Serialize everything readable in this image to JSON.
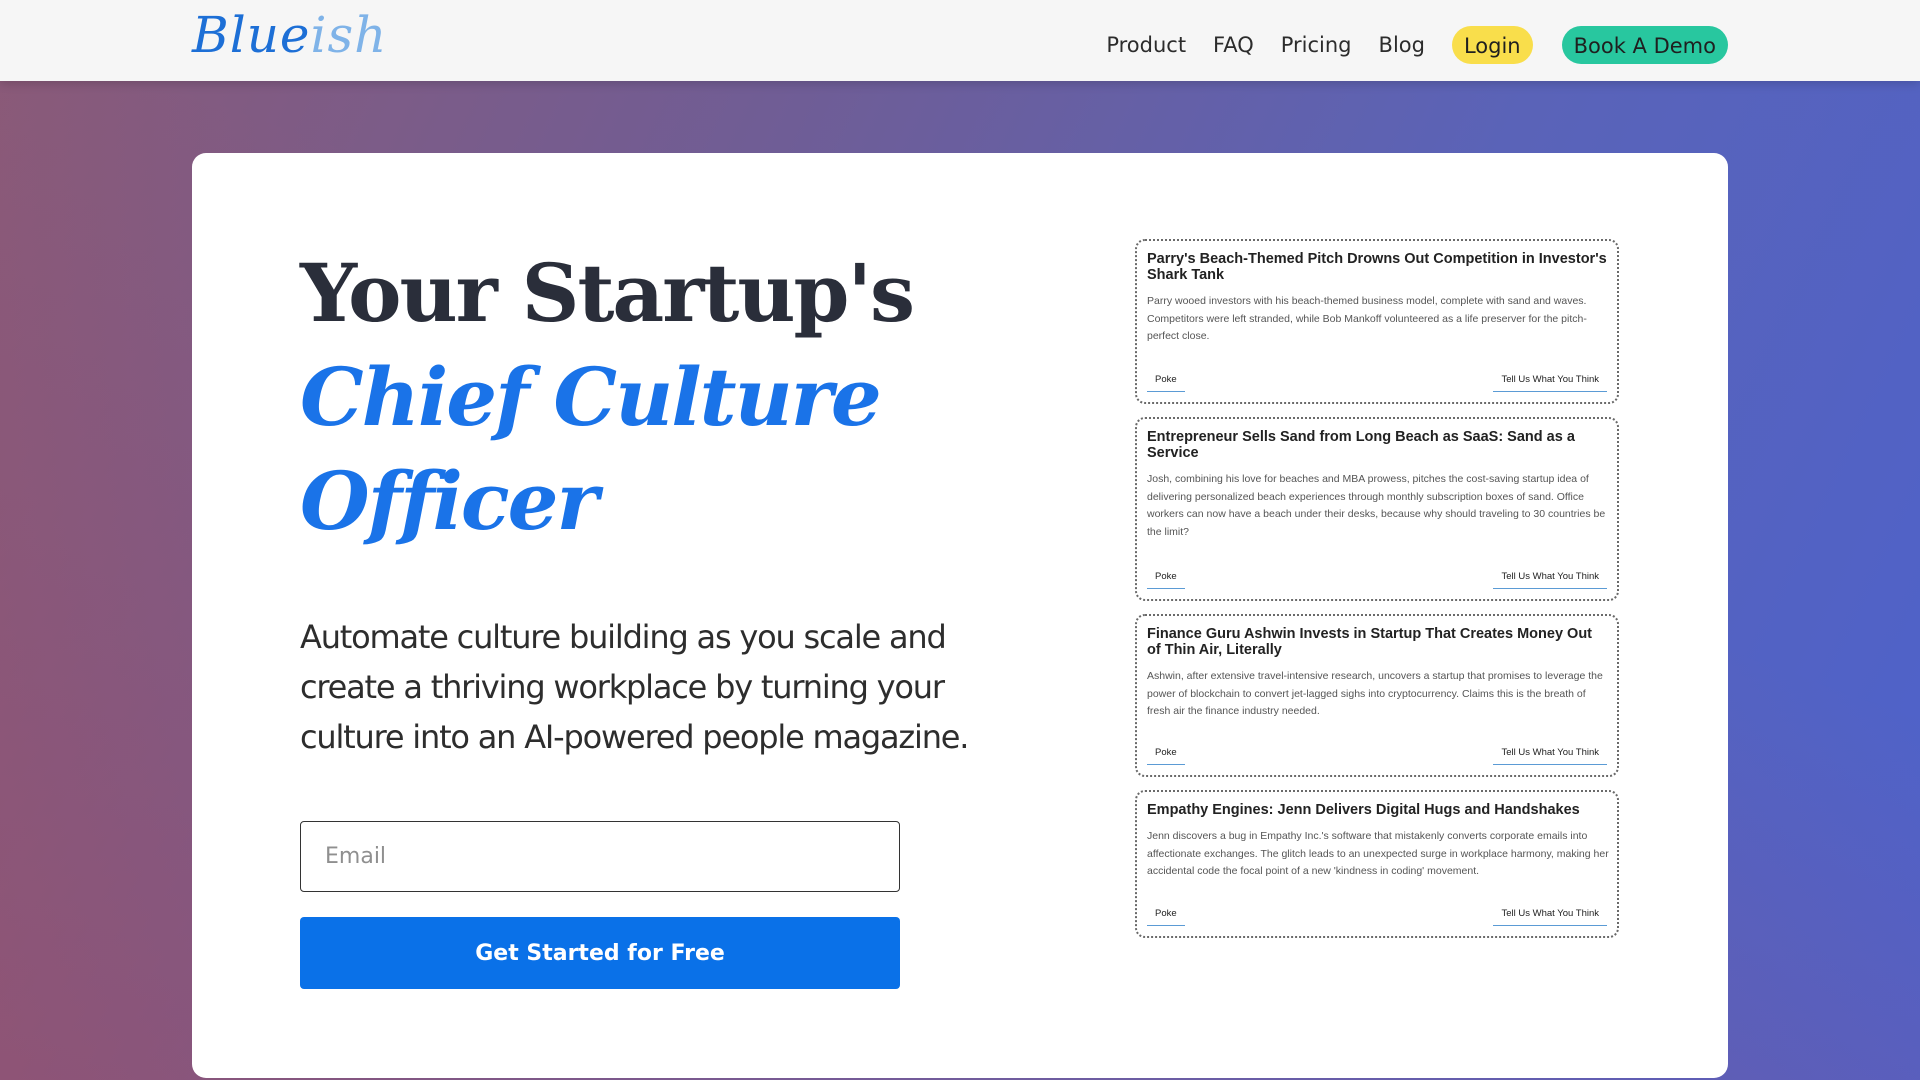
{
  "header": {
    "logo_main": "Blue",
    "logo_tail": "ish",
    "nav": {
      "product": "Product",
      "faq": "FAQ",
      "pricing": "Pricing",
      "blog": "Blog"
    },
    "login_label": "Login",
    "demo_label": "Book A Demo",
    "colors": {
      "login_bg": "#f9de4b",
      "demo_bg": "#28c79f",
      "logo": "#1d6fd6"
    }
  },
  "hero": {
    "headline_line1": "Your Startup's",
    "headline_line2": "Chief Culture",
    "headline_line3": "Officer",
    "subtext": "Automate culture building as you scale and create a thriving workplace by turning your culture into an AI-powered people magazine.",
    "email_placeholder": "Email",
    "email_value": "",
    "cta_label": "Get Started for Free",
    "accent_color": "#1a73e8",
    "cta_color": "#0a71e8"
  },
  "articles": [
    {
      "title": "Parry's Beach-Themed Pitch Drowns Out Competition in Investor's Shark Tank",
      "body": "Parry wooed investors with his beach-themed business model, complete with sand and waves. Competitors were left stranded, while Bob Mankoff volunteered as a life preserver for the pitch-perfect close.",
      "poke_label": "Poke",
      "feedback_label": "Tell Us What You Think"
    },
    {
      "title": "Entrepreneur Sells Sand from Long Beach as SaaS: Sand as a Service",
      "body": "Josh, combining his love for beaches and MBA prowess, pitches the cost-saving startup idea of delivering personalized beach experiences through monthly subscription boxes of sand. Office workers can now have a beach under their desks, because why should traveling to 30 countries be the limit?",
      "poke_label": "Poke",
      "feedback_label": "Tell Us What You Think"
    },
    {
      "title": "Finance Guru Ashwin Invests in Startup That Creates Money Out of Thin Air, Literally",
      "body": "Ashwin, after extensive travel-intensive research, uncovers a startup that promises to leverage the power of blockchain to convert jet-lagged sighs into cryptocurrency. Claims this is the breath of fresh air the finance industry needed.",
      "poke_label": "Poke",
      "feedback_label": "Tell Us What You Think"
    },
    {
      "title": "Empathy Engines: Jenn Delivers Digital Hugs and Handshakes",
      "body": "Jenn discovers a bug in Empathy Inc.'s software that mistakenly converts corporate emails into affectionate exchanges. The glitch leads to an unexpected surge in workplace harmony, making her accidental code the focal point of a new 'kindness in coding' movement.",
      "poke_label": "Poke",
      "feedback_label": "Tell Us What You Think"
    }
  ]
}
